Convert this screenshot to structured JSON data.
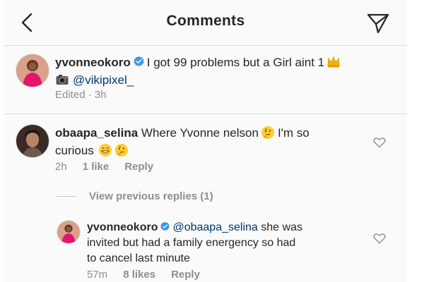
{
  "header": {
    "title": "Comments"
  },
  "caption": {
    "username": "yvonneokoro",
    "text": "I got 99 problems but a Girl aint 1",
    "mention": "@vikipixel_",
    "meta": "Edited · 3h"
  },
  "comments": [
    {
      "username": "obaapa_selina",
      "text_line1": "Where Yvonne nelson",
      "text_line1_after": "I'm so",
      "text_line2": "curious",
      "time": "2h",
      "likes": "1 like",
      "reply": "Reply"
    }
  ],
  "view_previous_replies": "View previous replies (1)",
  "replies": [
    {
      "username": "yvonneokoro",
      "mention": "@obaapa_selina",
      "text_line1_after": "she was",
      "text_line2": "invited but had a family energency so had",
      "text_line3": "to cancel last minute",
      "time": "57m",
      "likes": "8 likes",
      "reply": "Reply"
    }
  ],
  "colors": {
    "text": "#262626",
    "secondary": "#8e8e8e",
    "verified_blue": "#3897f0",
    "mention": "#00376b",
    "divider": "#dbdbdb"
  },
  "icons": [
    "back-icon",
    "send-icon",
    "verified-icon",
    "crown-icon",
    "camera-icon",
    "thinking-face-icon",
    "grinning-face-icon",
    "heart-icon"
  ]
}
